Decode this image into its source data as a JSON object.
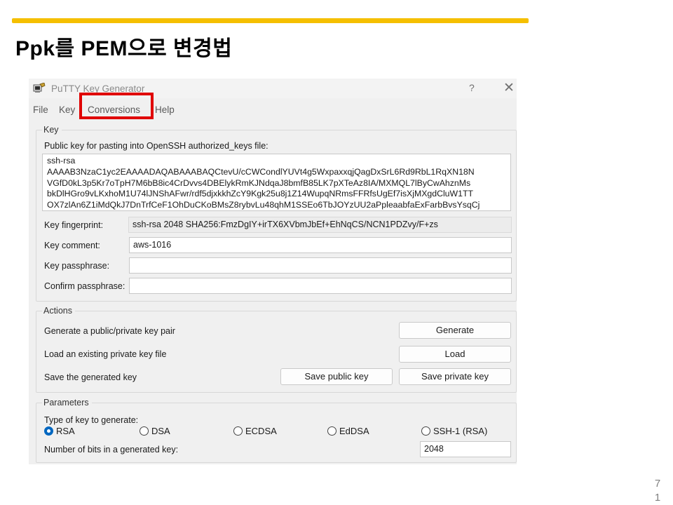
{
  "slide": {
    "title": "Ppk를 PEM으로 변경법",
    "page_number_line1": "7",
    "page_number_line2": "1",
    "accent_color": "#f5bf00"
  },
  "window": {
    "title": "PuTTY Key Generator",
    "help_glyph": "?",
    "close_glyph": "✕",
    "icon": "putty-keygen-icon"
  },
  "menu": {
    "items": [
      "File",
      "Key",
      "Conversions",
      "Help"
    ],
    "highlighted": "Conversions",
    "highlight_color": "#e00000"
  },
  "key_group": {
    "legend": "Key",
    "public_key_label": "Public key for pasting into OpenSSH authorized_keys file:",
    "public_key_lines": [
      "ssh-rsa",
      "AAAAB3NzaC1yc2EAAAADAQABAAABAQCtevU/cCWCondlYUVt4g5WxpaxxqjQagDxSrL6Rd9RbL1RqXN18N",
      "VGfD0kL3p5Kr7oTpH7M6bB8ic4CrDvvs4DBElykRmKJNdqaJ8bmfB85LK7pXTeAz8IA/MXMQL7lByCwAhznMs",
      "bkDlHGro9vLKxhoM1U74lJNShAFwr/rdf5djxkkhZcY9Kgk25u8j1Z14WupqNRmsFFRfsUgEf7isXjMXgdCluW1TT",
      "OX7zlAn6Z1iMdQkJ7DnTrfCeF1OhDuCKoBMsZ8rybvLu48qhM1SSEo6TbJOYzUU2aPpleaabfaExFarbBvsYsqCj"
    ],
    "fingerprint_label": "Key fingerprint:",
    "fingerprint_value": "ssh-rsa 2048 SHA256:FmzDgIY+irTX6XVbmJbEf+EhNqCS/NCN1PDZvy/F+zs",
    "comment_label": "Key comment:",
    "comment_value": "aws-1016",
    "passphrase_label": "Key passphrase:",
    "passphrase_value": "",
    "confirm_label": "Confirm passphrase:",
    "confirm_value": ""
  },
  "actions_group": {
    "legend": "Actions",
    "generate_label": "Generate a public/private key pair",
    "generate_button": "Generate",
    "load_label": "Load an existing private key file",
    "load_button": "Load",
    "save_label": "Save the generated key",
    "save_public_button": "Save public key",
    "save_private_button": "Save private key"
  },
  "parameters_group": {
    "legend": "Parameters",
    "type_label": "Type of key to generate:",
    "key_types": [
      "RSA",
      "DSA",
      "ECDSA",
      "EdDSA",
      "SSH-1 (RSA)"
    ],
    "selected_type": "RSA",
    "bits_label": "Number of bits in a generated key:",
    "bits_value": "2048"
  }
}
